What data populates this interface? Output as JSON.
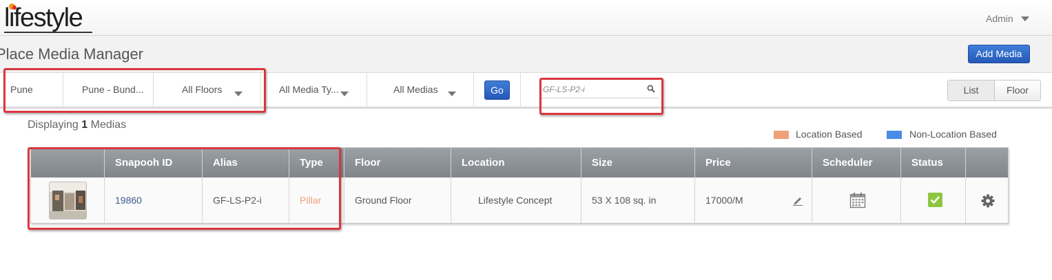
{
  "header": {
    "logo_text": "lifestyle",
    "user_menu_label": "Admin"
  },
  "page": {
    "title": "Place Media Manager",
    "add_button_label": "Add Media"
  },
  "filters": {
    "city": "Pune",
    "place": "Pune - Bund...",
    "floor": "All Floors",
    "media_type": "All Media Ty...",
    "medias": "All Medias",
    "go_label": "Go",
    "search_value": "GF-LS-P2-i",
    "view_list_label": "List",
    "view_floor_label": "Floor"
  },
  "summary": {
    "prefix": "Displaying",
    "count": "1",
    "suffix": "Medias"
  },
  "legend": {
    "location_based": "Location Based",
    "location_based_color": "#f0a07a",
    "non_location_based": "Non-Location Based",
    "non_location_based_color": "#4a8de6"
  },
  "table": {
    "headers": [
      "Snapooh ID",
      "Alias",
      "Type",
      "Floor",
      "Location",
      "Size",
      "Price",
      "Scheduler",
      "Status"
    ],
    "rows": [
      {
        "id": "19860",
        "alias": "GF-LS-P2-i",
        "type": "Pillar",
        "type_color": "#f0a07a",
        "floor": "Ground Floor",
        "location": "Lifestyle Concept",
        "size": "53 X 108 sq. in",
        "price": "17000/M"
      }
    ]
  },
  "icons": {
    "search": "search-icon",
    "edit": "pencil-icon",
    "scheduler": "calendar-icon",
    "status": "check-icon",
    "settings": "gear-icon"
  }
}
